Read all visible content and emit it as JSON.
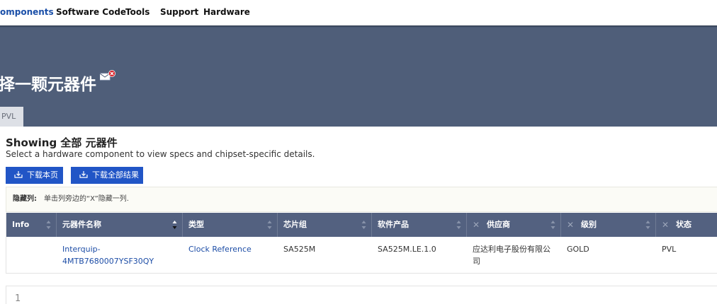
{
  "nav": {
    "items": [
      {
        "label": "omponents",
        "active": true
      },
      {
        "label": "Software Code",
        "active": false
      },
      {
        "label": "Tools",
        "active": false
      },
      {
        "label": "Support",
        "active": false
      },
      {
        "label": "Hardware",
        "active": false
      }
    ]
  },
  "banner": {
    "title": "择一颗元器件",
    "tab_label": "PVL",
    "icon": "mail-error-icon"
  },
  "main": {
    "showing_label": "Showing 全部 元器件",
    "subtitle": "Select a hardware component to view specs and chipset-specific details.",
    "buttons": {
      "download_page": "下载本页",
      "download_all": "下载全部结果"
    },
    "hide_bar": {
      "label": "隐藏列:",
      "hint": "单击列旁边的“X”隐藏一列."
    }
  },
  "table": {
    "columns": [
      {
        "label": "Info",
        "hideable": false
      },
      {
        "label": "元器件名称",
        "hideable": false,
        "sorted": true
      },
      {
        "label": "类型",
        "hideable": false
      },
      {
        "label": "芯片组",
        "hideable": false
      },
      {
        "label": "软件产品",
        "hideable": false
      },
      {
        "label": "供应商",
        "hideable": true
      },
      {
        "label": "级别",
        "hideable": true
      },
      {
        "label": "状态",
        "hideable": true
      }
    ],
    "rows": [
      {
        "info": "",
        "name_line1": "Interquip-",
        "name_line2": "4MTB7680007YSF30QY",
        "type": "Clock Reference",
        "chipset": "SA525M",
        "software": "SA525M.LE.1.0",
        "vendor_line1": "应达利电子股份有限公",
        "vendor_line2": "司",
        "level": "GOLD",
        "status": "PVL"
      }
    ]
  },
  "pagination": {
    "current_page": "1"
  },
  "colors": {
    "banner_bg": "#4f5e79",
    "header_bg": "#536180",
    "button_bg": "#2155c6",
    "link": "#1d4da6"
  }
}
